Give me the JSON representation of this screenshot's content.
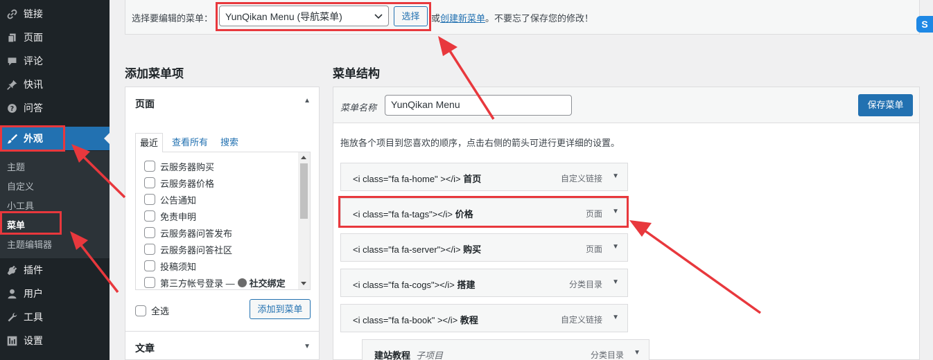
{
  "sidebar": {
    "items": [
      {
        "label": "链接",
        "icon": "link-icon"
      },
      {
        "label": "页面",
        "icon": "pages-icon"
      },
      {
        "label": "评论",
        "icon": "comments-icon"
      },
      {
        "label": "快讯",
        "icon": "pin-icon"
      },
      {
        "label": "问答",
        "icon": "question-icon"
      },
      {
        "label": "外观",
        "icon": "appearance-brush-icon"
      },
      {
        "label": "插件",
        "icon": "plugins-icon"
      },
      {
        "label": "用户",
        "icon": "users-icon"
      },
      {
        "label": "工具",
        "icon": "tools-icon"
      },
      {
        "label": "设置",
        "icon": "settings-icon"
      }
    ],
    "submenu": [
      "主题",
      "自定义",
      "小工具",
      "菜单",
      "主题编辑器"
    ]
  },
  "topbar": {
    "select_label": "选择要编辑的菜单：",
    "selected_menu": "YunQikan Menu (导航菜单)",
    "select_button": "选择",
    "note_prefix": "或",
    "note_link": "创建新菜单",
    "note_suffix": "。不要忘了保存您的修改！"
  },
  "add_items": {
    "heading": "添加菜单项",
    "pages_title": "页面",
    "tabs": [
      "最近",
      "查看所有",
      "搜索"
    ],
    "pages": [
      "云服务器购买",
      "云服务器价格",
      "公告通知",
      "免责申明",
      "云服务器问答发布",
      "云服务器问答社区",
      "投稿须知",
      "第三方帐号登录 — ",
      "社交绑定"
    ],
    "select_all": "全选",
    "add_button": "添加到菜单",
    "posts_title": "文章"
  },
  "structure": {
    "heading": "菜单结构",
    "name_label": "菜单名称",
    "name_value": "YunQikan Menu",
    "save_button": "保存菜单",
    "instructions": "拖放各个项目到您喜欢的顺序，点击右侧的箭头可进行更详细的设置。",
    "items": [
      {
        "code": "<i class=\"fa fa-home\" ></i> ",
        "name": "首页",
        "type": "自定义链接"
      },
      {
        "code": "<i class=\"fa fa-tags\"></i> ",
        "name": "价格",
        "type": "页面"
      },
      {
        "code": "<i class=\"fa fa-server\"></i> ",
        "name": "购买",
        "type": "页面"
      },
      {
        "code": "<i class=\"fa fa-cogs\"></i> ",
        "name": "搭建",
        "type": "分类目录"
      },
      {
        "code": "<i class=\"fa fa-book\" ></i> ",
        "name": "教程",
        "type": "自定义链接"
      },
      {
        "code": "",
        "name": "建站教程",
        "sub": "子项目",
        "type": "分类目录"
      }
    ]
  },
  "colors": {
    "sidebar_bg": "#1d2327",
    "accent": "#2271b1",
    "annotation_red": "#e8383d"
  }
}
